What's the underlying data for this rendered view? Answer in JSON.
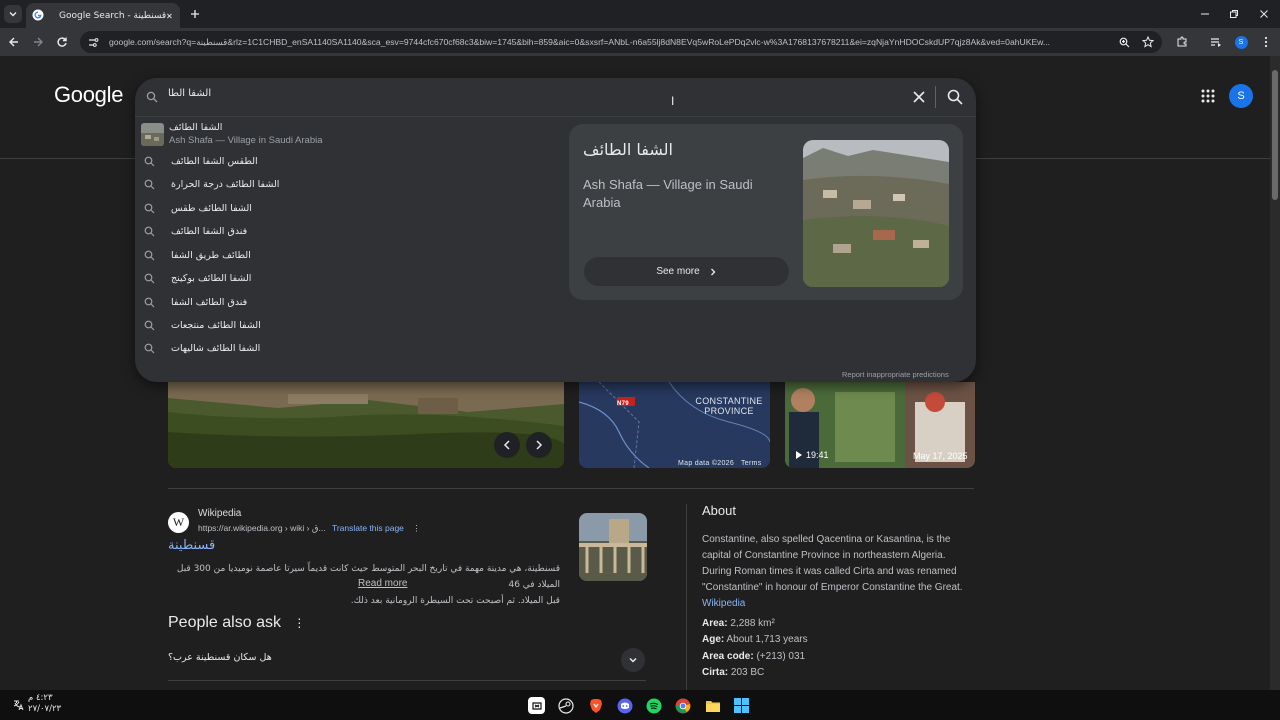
{
  "browser": {
    "tab_title": "Google Search - قسنطينة",
    "url": "google.com/search?q=قسنطينة&rlz=1C1CHBD_enSA1140SA1140&sca_esv=9744cfc670cf68c3&biw=1745&bih=859&aic=0&sxsrf=ANbL-n6a55lj8dN8EVq5wRoLePDq2vlc-w%3A1768137678211&ei=zqNjaYnHDOCskdUP7qjz8Ak&ved=0ahUKEw..."
  },
  "search": {
    "query": "الشفا الطا",
    "report_text": "Report inappropriate predictions"
  },
  "suggestions": {
    "first": {
      "title": "الشفا الطائف",
      "subtitle": "Ash Shafa — Village in Saudi Arabia"
    },
    "items": [
      "الطقس الشفا الطائف",
      "الشفا الطائف درجة الحرارة",
      "الشفا الطائف طقس",
      "فندق الشفا الطائف",
      "الطائف طريق الشفا",
      "الشفا الطائف بوكينج",
      "فندق الطائف الشفا",
      "الشفا الطائف منتجعات",
      "الشفا الطائف شاليهات"
    ]
  },
  "knowledge_preview": {
    "title": "الشفا الطائف",
    "subtitle": "Ash Shafa — Village in Saudi Arabia",
    "see_more": "See more"
  },
  "header": {
    "logo": "Google",
    "avatar_letter": "S"
  },
  "carousel": {
    "map_region": "CONSTANTINE PROVINCE",
    "map_road": "N79",
    "map_data": "Map data ©2026",
    "terms": "Terms",
    "video_duration": "19:41",
    "image_date": "May 17, 2025"
  },
  "result": {
    "source_name": "Wikipedia",
    "source_url": "https://ar.wikipedia.org › wiki › ق...",
    "translate": "Translate this page",
    "title": "قسنطينة",
    "snippet_line1": "قسنطينة، هي مدينة مهمة في تاريخ البحر المتوسط حيث كانت قديماً سيرتا عاصمة نوميديا من 300 قبل الميلاد في 46",
    "snippet_line2": "قبل الميلاد. ثم أصبحت تحت السيطرة الرومانية بعد ذلك.",
    "read_more": "Read more"
  },
  "paa": {
    "heading": "People also ask",
    "question": "هل سكان قسنطينة عرب؟"
  },
  "about": {
    "heading": "About",
    "text": "Constantine, also spelled Qacentina or Kasantina, is the capital of Constantine Province in northeastern Algeria. During Roman times it was called Cirta and was renamed \"Constantine\" in honour of Emperor Constantine the Great.",
    "wiki_link": "Wikipedia",
    "facts": [
      {
        "label": "Area:",
        "value": "2,288 km²"
      },
      {
        "label": "Age:",
        "value": "About 1,713 years"
      },
      {
        "label": "Area code:",
        "value": "(+213) 031"
      },
      {
        "label": "Cirta:",
        "value": "203 BC"
      }
    ]
  },
  "taskbar": {
    "time": "٤:٢٣ م",
    "date": "٢٧/٠٧/٢٣"
  },
  "colors": {
    "accent": "#1a73e8",
    "link": "#8ab4f8",
    "background": "#1f1f1f"
  }
}
